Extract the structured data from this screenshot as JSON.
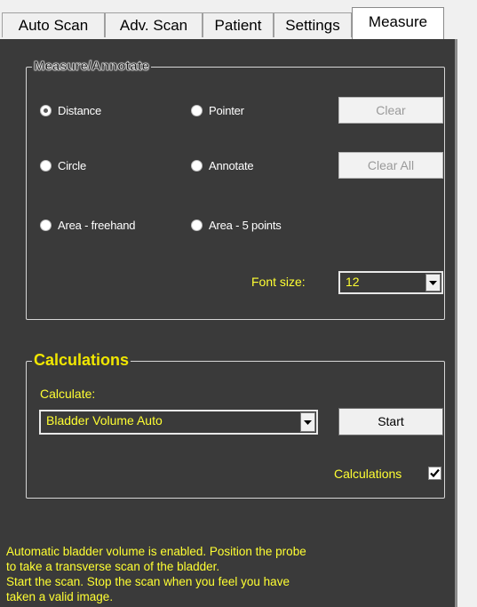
{
  "tabs": [
    {
      "label": "Auto Scan"
    },
    {
      "label": "Adv. Scan"
    },
    {
      "label": "Patient"
    },
    {
      "label": "Settings"
    },
    {
      "label": "Measure"
    }
  ],
  "measure": {
    "group_title": "Measure/Annotate",
    "radios": [
      {
        "label": "Distance",
        "checked": true
      },
      {
        "label": "Pointer",
        "checked": false
      },
      {
        "label": "Circle",
        "checked": false
      },
      {
        "label": "Annotate",
        "checked": false
      },
      {
        "label": "Area - freehand",
        "checked": false
      },
      {
        "label": "Area - 5 points",
        "checked": false
      }
    ],
    "clear_label": "Clear",
    "clear_all_label": "Clear All",
    "font_size_label": "Font size:",
    "font_size_value": "12"
  },
  "calculations": {
    "group_title": "Calculations",
    "calculate_label": "Calculate:",
    "calculate_value": "Bladder Volume Auto",
    "start_label": "Start",
    "checkbox_label": "Calculations",
    "checkbox_checked": true
  },
  "status_lines": [
    "Automatic bladder volume is enabled. Position the probe",
    "to take a transverse scan of the bladder.",
    "Start the scan. Stop the scan when you feel you have",
    "taken a valid image."
  ],
  "colors": {
    "panel_bg": "#3a3a3a",
    "accent_yellow": "#ffff33",
    "title_yellow": "#f0e600"
  }
}
